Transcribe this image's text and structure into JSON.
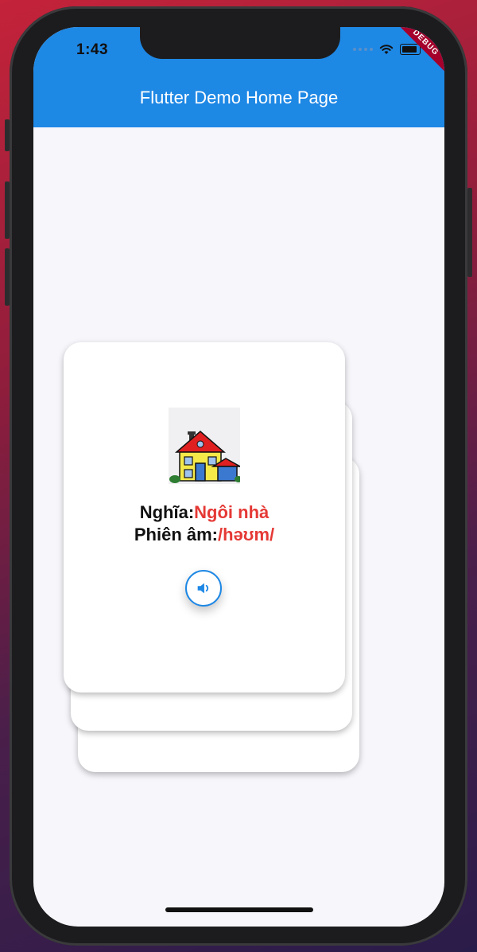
{
  "status_bar": {
    "time": "1:43"
  },
  "debug_banner": "DEBUG",
  "app_bar": {
    "title": "Flutter Demo Home Page"
  },
  "flashcard": {
    "image_icon": "house-icon",
    "meaning_label": "Nghĩa:",
    "meaning_value": "Ngôi nhà",
    "pronunciation_label": "Phiên âm:",
    "pronunciation_value": "/həʊm/",
    "audio_icon": "speaker-icon"
  },
  "colors": {
    "app_bar": "#1e88e5",
    "accent_text": "#e53935",
    "background": "#f7f6fb"
  }
}
